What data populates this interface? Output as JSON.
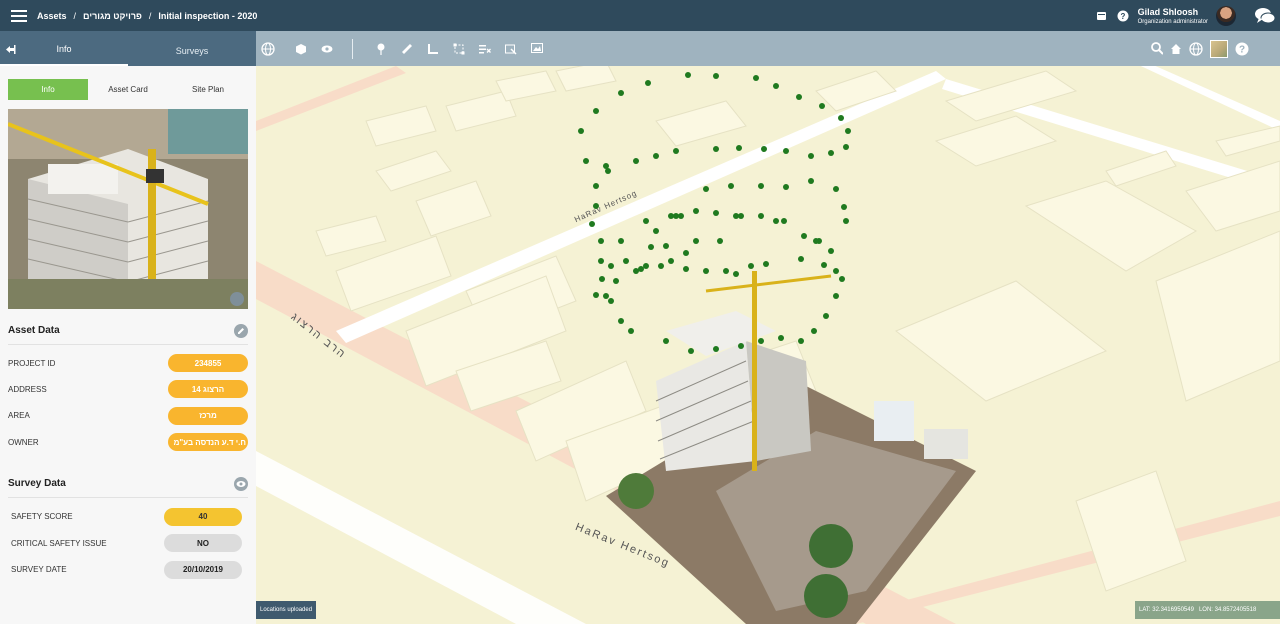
{
  "topbar": {
    "breadcrumb": [
      "Assets",
      "פרויקט מגורים",
      "Initial inspection - 2020"
    ],
    "separator": "/",
    "user_name": "Gilad Shloosh",
    "user_role": "Organization administrator"
  },
  "sidebar": {
    "tabs": [
      "Info",
      "Surveys"
    ],
    "subtabs": [
      "Info",
      "Asset Card",
      "Site Plan"
    ],
    "asset_data": {
      "title": "Asset Data",
      "rows": [
        {
          "label": "PROJECT ID",
          "value": "234855"
        },
        {
          "label": "ADDRESS",
          "value": "הרצוג 14"
        },
        {
          "label": "AREA",
          "value": "מרכז"
        },
        {
          "label": "OWNER",
          "value": "ח.י ד.ע הנדסה בע\"מ"
        }
      ]
    },
    "survey_data": {
      "title": "Survey Data",
      "rows": [
        {
          "label": "SAFETY SCORE",
          "value": "40"
        },
        {
          "label": "CRITICAL SAFETY ISSUE",
          "value": "NO"
        },
        {
          "label": "SURVEY DATE",
          "value": "20/10/2019"
        }
      ]
    }
  },
  "map": {
    "street_labels": [
      "HaRav Hertsog",
      "הרב הרצוג",
      "HaRav Hertsog"
    ],
    "status_left": "Locations uploaded",
    "lat": "LAT: 32.3416950549",
    "lon": "LON: 34.8572405518"
  },
  "colors": {
    "accent_green": "#77c04f",
    "header": "#2f4a5c",
    "flight_dots": "#1f7a1f"
  }
}
